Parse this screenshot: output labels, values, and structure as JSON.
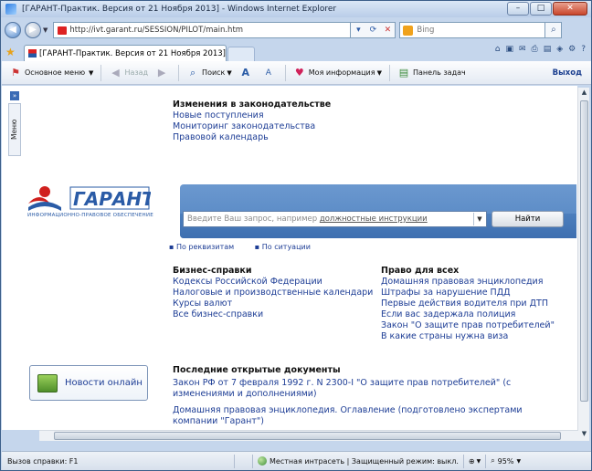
{
  "window": {
    "title": "[ГАРАНТ-Практик. Версия от 21 Ноября 2013] - Windows Internet Explorer",
    "min": "–",
    "max": "□",
    "close": "✕"
  },
  "browser": {
    "address": "http://ivt.garant.ru/SESSION/PILOT/main.htm",
    "search_placeholder": "Bing",
    "tab_title": "[ГАРАНТ-Практик. Версия от 21 Ноября 2013]"
  },
  "app_toolbar": {
    "main_menu": "Основное меню",
    "back": "Назад",
    "search": "Поиск",
    "my_info": "Моя информация",
    "taskbar": "Панель задач",
    "exit": "Выход"
  },
  "side_menu": "Меню",
  "legislation": {
    "heading": "Изменения в законодательстве",
    "links": [
      "Новые поступления",
      "Мониторинг законодательства",
      "Правовой календарь"
    ]
  },
  "search": {
    "placeholder_prefix": "Введите Ваш запрос, например ",
    "placeholder_example": "должностные инструкции",
    "button": "Найти",
    "sub_links": [
      "По реквизитам",
      "По ситуации"
    ]
  },
  "logo": {
    "name": "ГАРАНТ",
    "caption": "ИНФОРМАЦИОННО-ПРАВОВОЕ ОБЕСПЕЧЕНИЕ"
  },
  "business": {
    "heading": "Бизнес-справки",
    "links": [
      "Кодексы Российской Федерации",
      "Налоговые и производственные календари",
      "Курсы валют",
      "Все бизнес-справки"
    ]
  },
  "law_for_all": {
    "heading": "Право для всех",
    "links": [
      "Домашняя правовая энциклопедия",
      "Штрафы за нарушение ПДД",
      "Первые действия водителя при ДТП",
      "Если вас задержала полиция",
      "Закон \"О защите прав потребителей\"",
      "В какие страны нужна виза"
    ]
  },
  "news_online": "Новости онлайн",
  "recent": {
    "heading": "Последние открытые документы",
    "docs": [
      "Закон РФ от 7 февраля 1992 г. N 2300-I \"О защите прав потребителей\" (с изменениями и дополнениями)",
      "Домашняя правовая энциклопедия. Оглавление (подготовлено экспертами компании \"Гарант\")"
    ]
  },
  "statusbar": {
    "text": "Вызов справки: F1",
    "zone": "Местная интрасеть | Защищенный режим: выкл.",
    "zoom": "95%"
  }
}
